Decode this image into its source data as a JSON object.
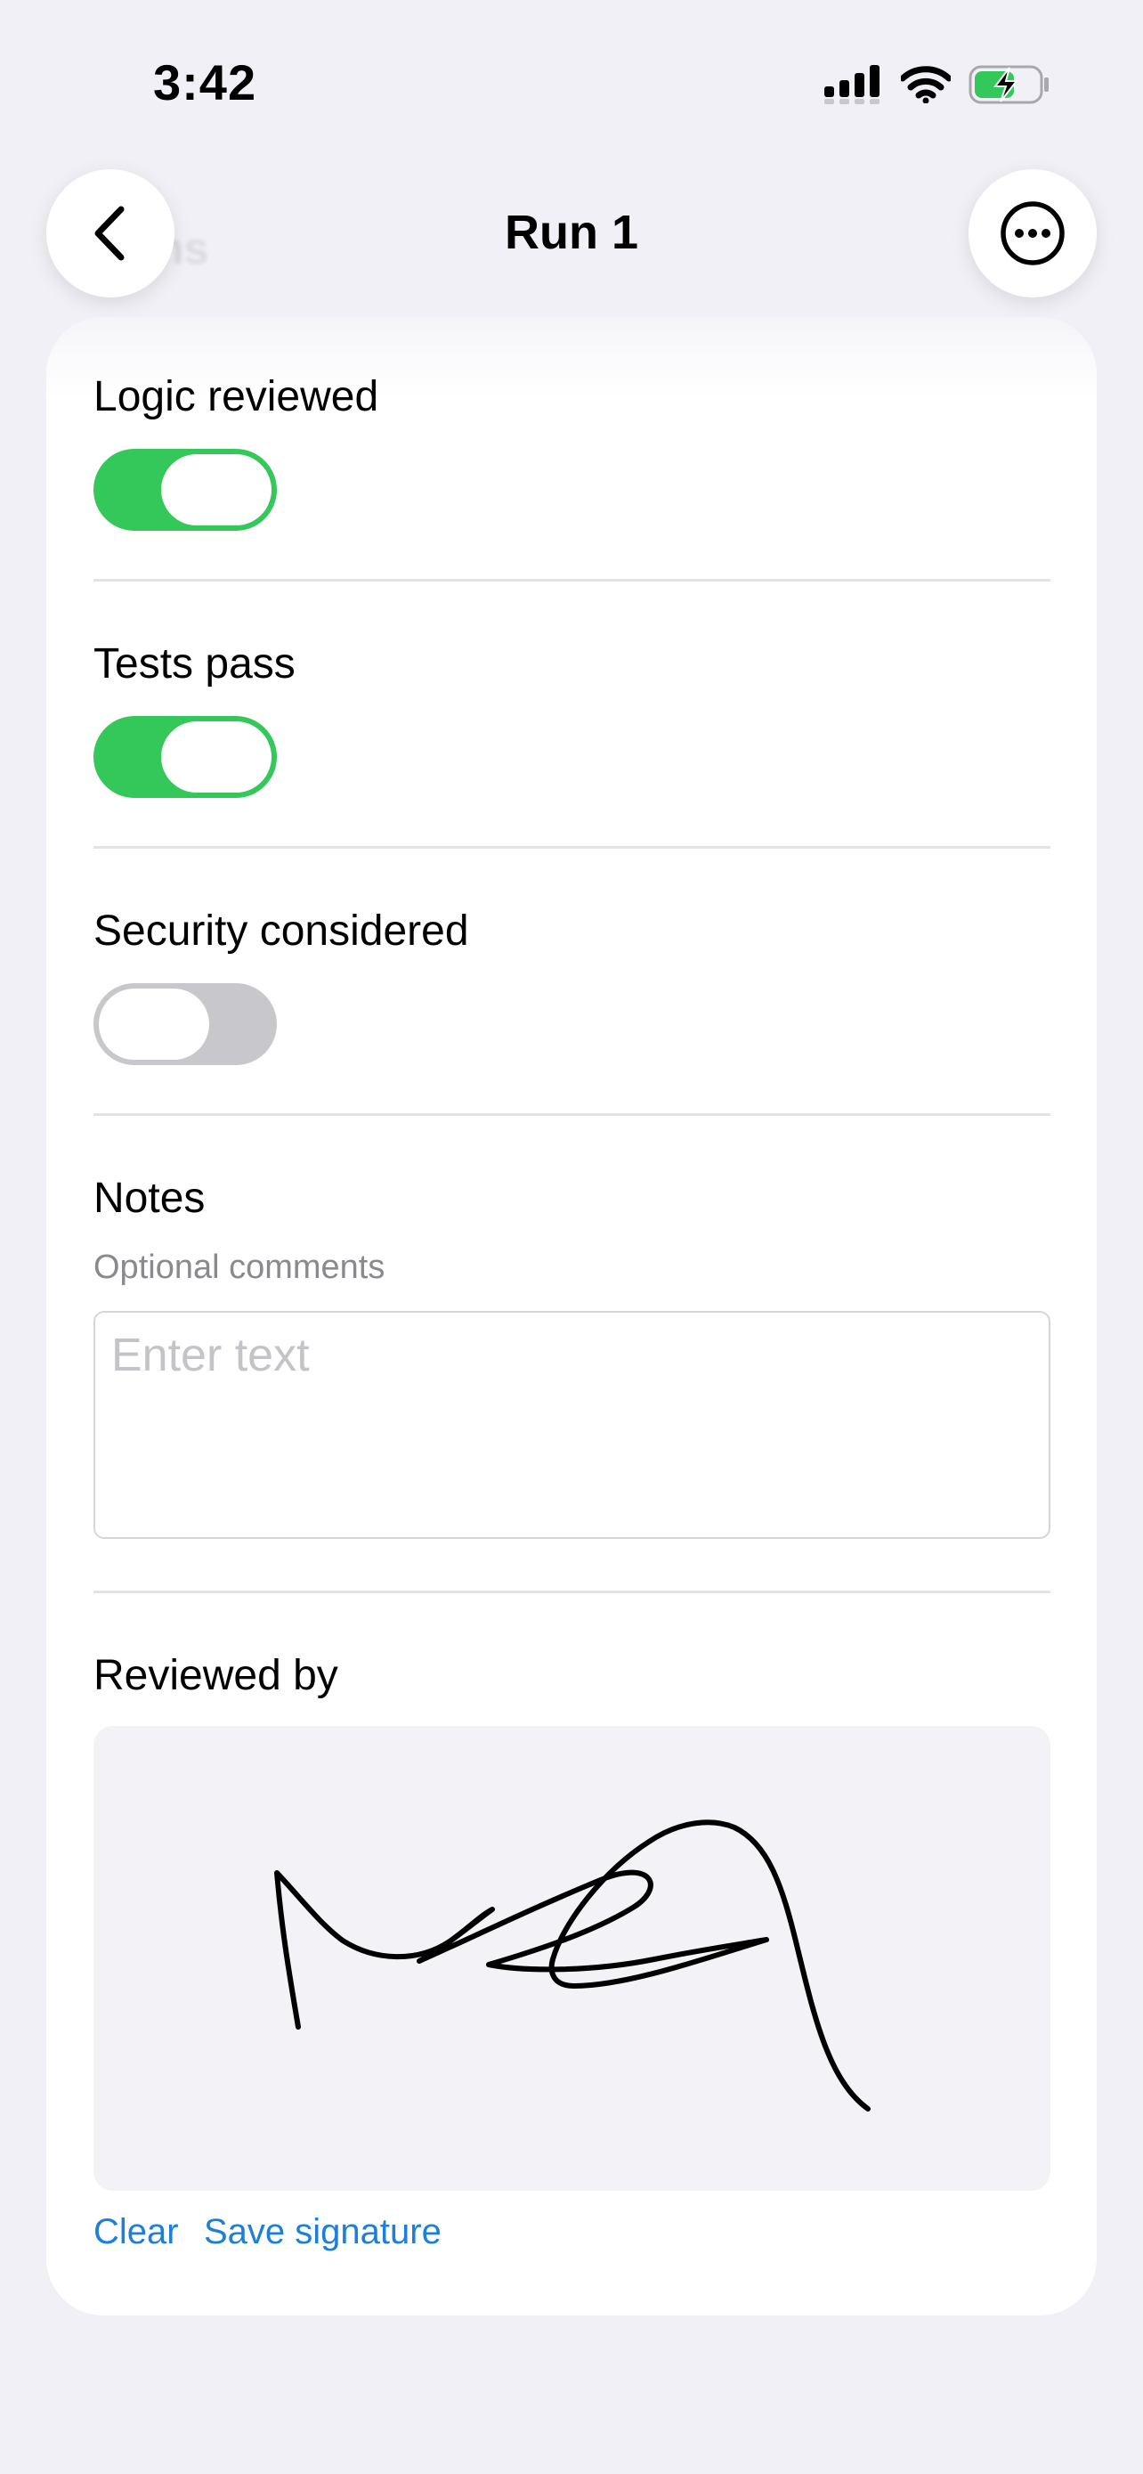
{
  "status_bar": {
    "time": "3:42",
    "icons": [
      "cellular-signal-icon",
      "wifi-icon",
      "battery-charging-icon"
    ]
  },
  "nav": {
    "title": "Run 1",
    "ghost_title": "ns",
    "back_icon": "chevron-left-icon",
    "more_icon": "ellipsis-circle-icon"
  },
  "form": {
    "logic_reviewed": {
      "label": "Logic reviewed",
      "value": true
    },
    "tests_pass": {
      "label": "Tests pass",
      "value": true
    },
    "security_considered": {
      "label": "Security considered",
      "value": false
    },
    "notes": {
      "label": "Notes",
      "helper": "Optional comments",
      "placeholder": "Enter text",
      "value": ""
    },
    "reviewed_by": {
      "label": "Reviewed by",
      "clear_label": "Clear",
      "save_label": "Save signature"
    }
  },
  "colors": {
    "toggle_on": "#34c759",
    "toggle_off": "#c7c7cc",
    "link": "#1d7fd7",
    "background": "#f1f0f6"
  }
}
